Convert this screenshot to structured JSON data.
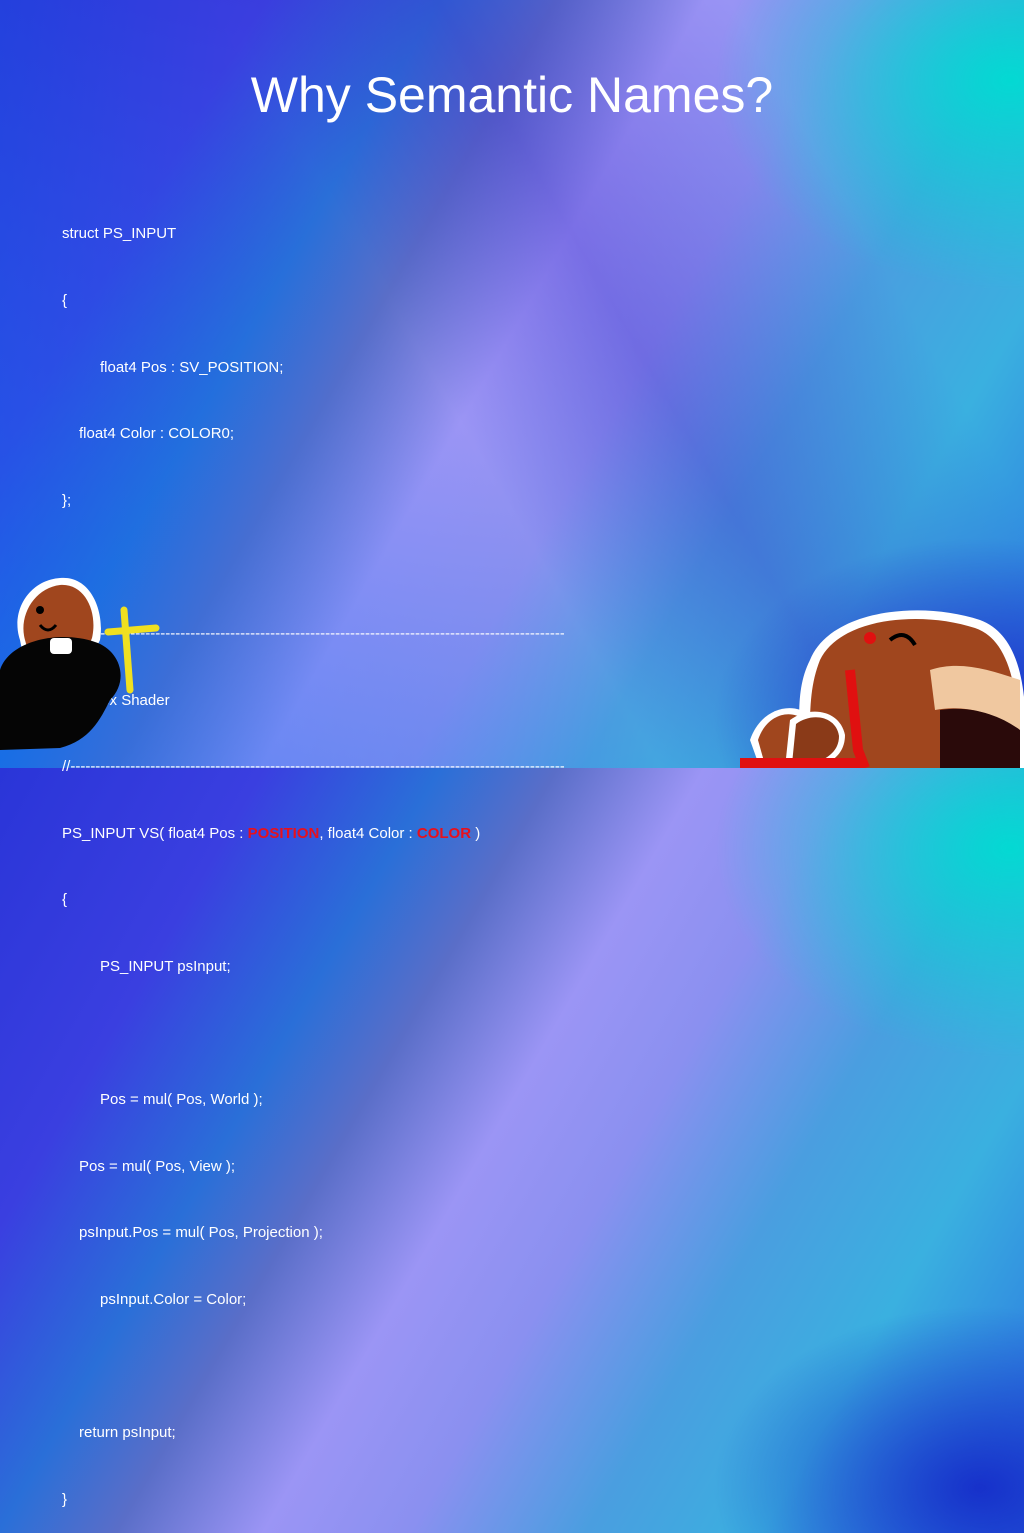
{
  "slide": {
    "title": "Why Semantic Names?",
    "code": {
      "l1": "struct PS_INPUT",
      "l2": "{",
      "l3": "float4 Pos : SV_POSITION;",
      "l4": "float4 Color : COLOR0;",
      "l5": "};",
      "l6": "//-----------------------------------------------------------------------------------------------------------",
      "l7": "// Vertex Shader",
      "l8": "//-----------------------------------------------------------------------------------------------------------",
      "l9a": "PS_INPUT VS( float4 Pos : ",
      "l9b": "POSITION",
      "l9c": ", float4 Color : ",
      "l9d": "COLOR",
      "l9e": " )",
      "l10": "{",
      "l11": "PS_INPUT psInput;",
      "l12": "Pos = mul( Pos, World );",
      "l13": "Pos = mul( Pos, View );",
      "l14": "psInput.Pos = mul( Pos, Projection );",
      "l15": "psInput.Color = Color;",
      "l16": "return psInput;",
      "l17": "}"
    },
    "highlight_color": "#e8101c",
    "illustrations": [
      "priest-creature-with-cross",
      "creature-eating-small-creatures"
    ]
  }
}
